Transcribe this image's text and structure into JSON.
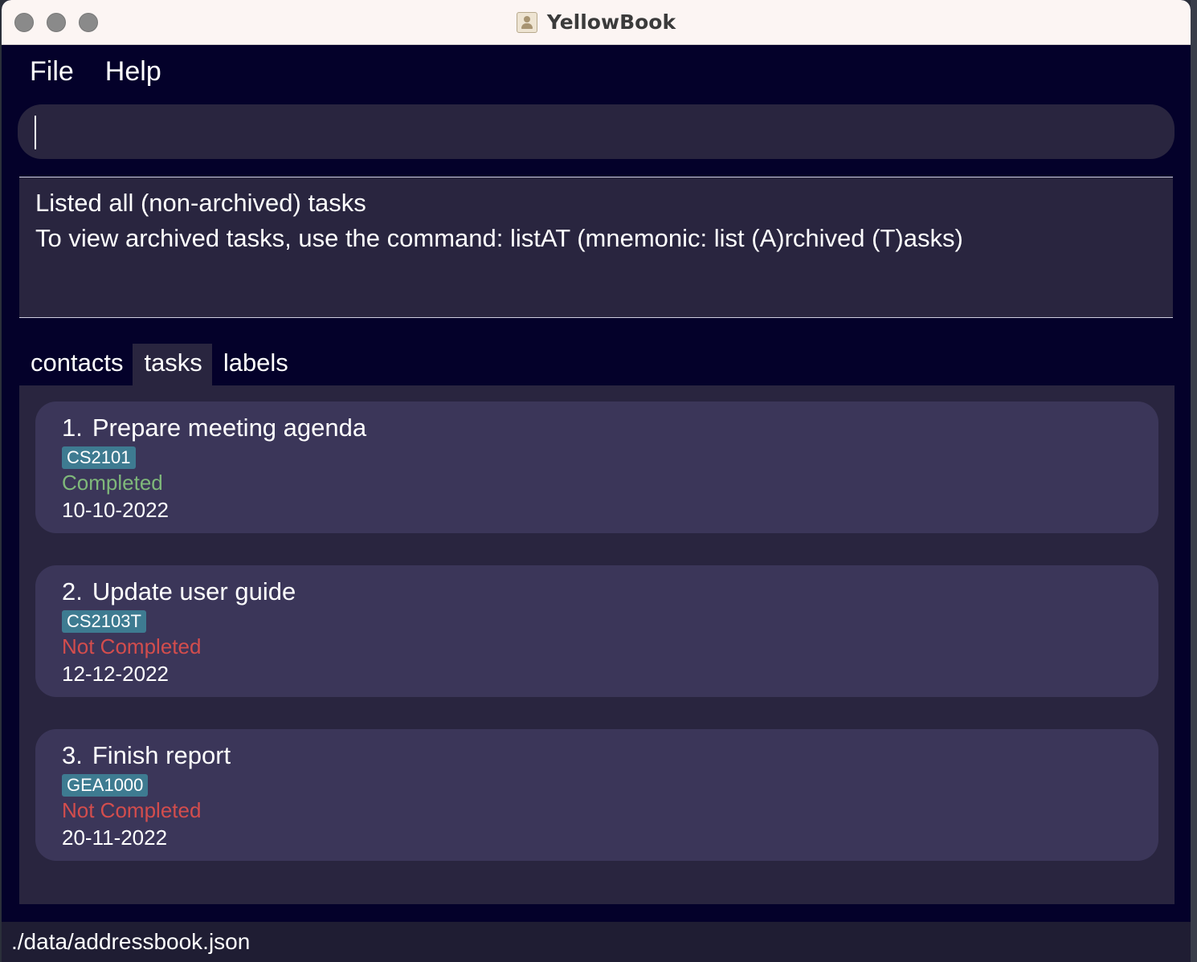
{
  "window": {
    "title": "YellowBook"
  },
  "menu": {
    "file": "File",
    "help": "Help"
  },
  "command": {
    "value": ""
  },
  "result": {
    "line1": "Listed all (non-archived) tasks",
    "line2": "To view archived tasks, use the command: listAT (mnemonic: list (A)rchived (T)asks)"
  },
  "tabs": [
    {
      "label": "contacts",
      "active": false
    },
    {
      "label": "tasks",
      "active": true
    },
    {
      "label": "labels",
      "active": false
    }
  ],
  "tasks": [
    {
      "index": "1.",
      "title": "Prepare meeting agenda",
      "label": "CS2101",
      "status": "Completed",
      "date": "10-10-2022"
    },
    {
      "index": "2.",
      "title": "Update user guide",
      "label": "CS2103T",
      "status": "Not Completed",
      "date": "12-12-2022"
    },
    {
      "index": "3.",
      "title": "Finish report",
      "label": "GEA1000",
      "status": "Not Completed",
      "date": "20-11-2022"
    }
  ],
  "statusbar": {
    "path": "./data/addressbook.json"
  },
  "colors": {
    "background": "#04012a",
    "panel": "#29253f",
    "card": "#3b3659",
    "tag": "#3e7b91",
    "completed": "#7fb87a",
    "not_completed": "#d34d4d"
  }
}
